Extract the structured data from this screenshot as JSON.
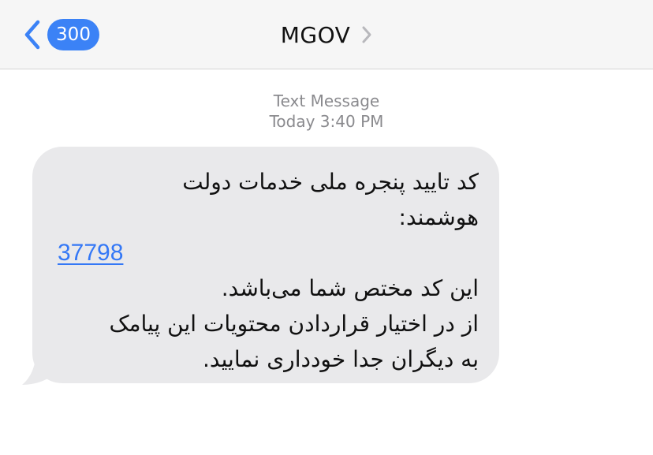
{
  "header": {
    "back_count": "300",
    "contact_name": "MGOV"
  },
  "meta": {
    "message_type": "Text Message",
    "time": "Today 3:40 PM"
  },
  "message": {
    "line1": "کد تایید پنجره ملی خدمات دولت",
    "line2": "هوشمند:",
    "code": "37798",
    "line3": "این کد مختص شما می‌باشد.",
    "line4": "از در اختیار قراردادن محتویات این پیامک",
    "line5": "به دیگران جدا خودداری نمایید."
  },
  "colors": {
    "accent": "#3b82f6",
    "link": "#3478f6",
    "bubble": "#e9e9eb",
    "nav_background": "#f6f6f6",
    "secondary_text": "#8a8a8e"
  },
  "icons": {
    "back": "chevron-left-icon",
    "details": "chevron-right-icon"
  }
}
